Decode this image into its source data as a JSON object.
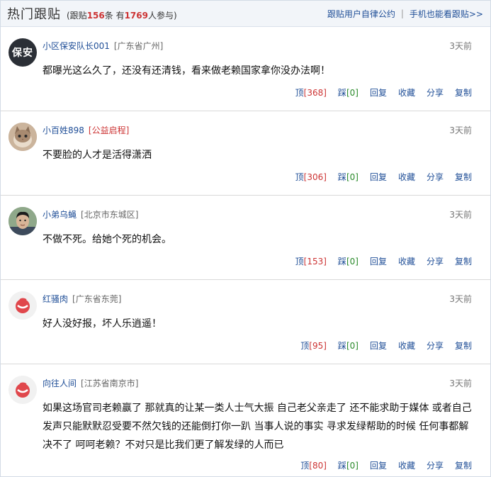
{
  "header": {
    "title": "热门跟贴",
    "stats_prefix": "(跟贴",
    "reply_count": "156",
    "stats_mid": "条 有",
    "participant_count": "1769",
    "stats_suffix": "人参与)",
    "link_rules": "跟贴用户自律公约",
    "separator": "|",
    "link_mobile": "手机也能看跟贴>>"
  },
  "comments": [
    {
      "user": "小区保安队长001",
      "location": "[广东省广州]",
      "time": "3天前",
      "avatar": "avatar-security-badge",
      "avatar_text": "保安",
      "text": "都曝光这么久了，还没有还清钱，看来做老赖国家拿你没办法啊！",
      "up": "[368]",
      "down": "[0]"
    },
    {
      "user": "小百姓898",
      "location": "[公益启程]",
      "time": "3天前",
      "avatar": "avatar-cat-photo",
      "text": "不要脸的人才是活得潇洒",
      "up": "[306]",
      "down": "[0]"
    },
    {
      "user": "小弟乌蝇",
      "location": "[北京市东城区]",
      "time": "3天前",
      "avatar": "avatar-person-photo",
      "text": "不做不死。给她个死的机会。",
      "up": "[153]",
      "down": "[0]"
    },
    {
      "user": "红骚肉",
      "location": "[广东省东莞]",
      "time": "3天前",
      "avatar": "avatar-default-red-logo",
      "text": "好人没好报，坏人乐逍遥！",
      "up": "[95]",
      "down": "[0]"
    },
    {
      "user": "向往人间",
      "location": "[江苏省南京市]",
      "time": "3天前",
      "avatar": "avatar-default-red-logo",
      "text": "如果这场官司老赖赢了 那就真的让某一类人士气大振 自己老父亲走了 还不能求助于媒体 或者自己发声只能默默忍受要不然欠钱的还能倒打你一趴 当事人说的事实 寻求发绿帮助的时候 任何事都解决不了 呵呵老赖？不对只是比我们更了解发绿的人而已",
      "up": "[80]",
      "down": "[0]"
    }
  ],
  "actions": {
    "up_label": "顶",
    "down_label": "踩",
    "reply_label": "回复",
    "favorite_label": "收藏",
    "share_label": "分享",
    "copy_label": "复制"
  },
  "colors": {
    "link_blue": "#1f4e97",
    "count_red": "#c33",
    "count_green": "#2a8a2a",
    "header_bg": "#f2f5f9"
  }
}
